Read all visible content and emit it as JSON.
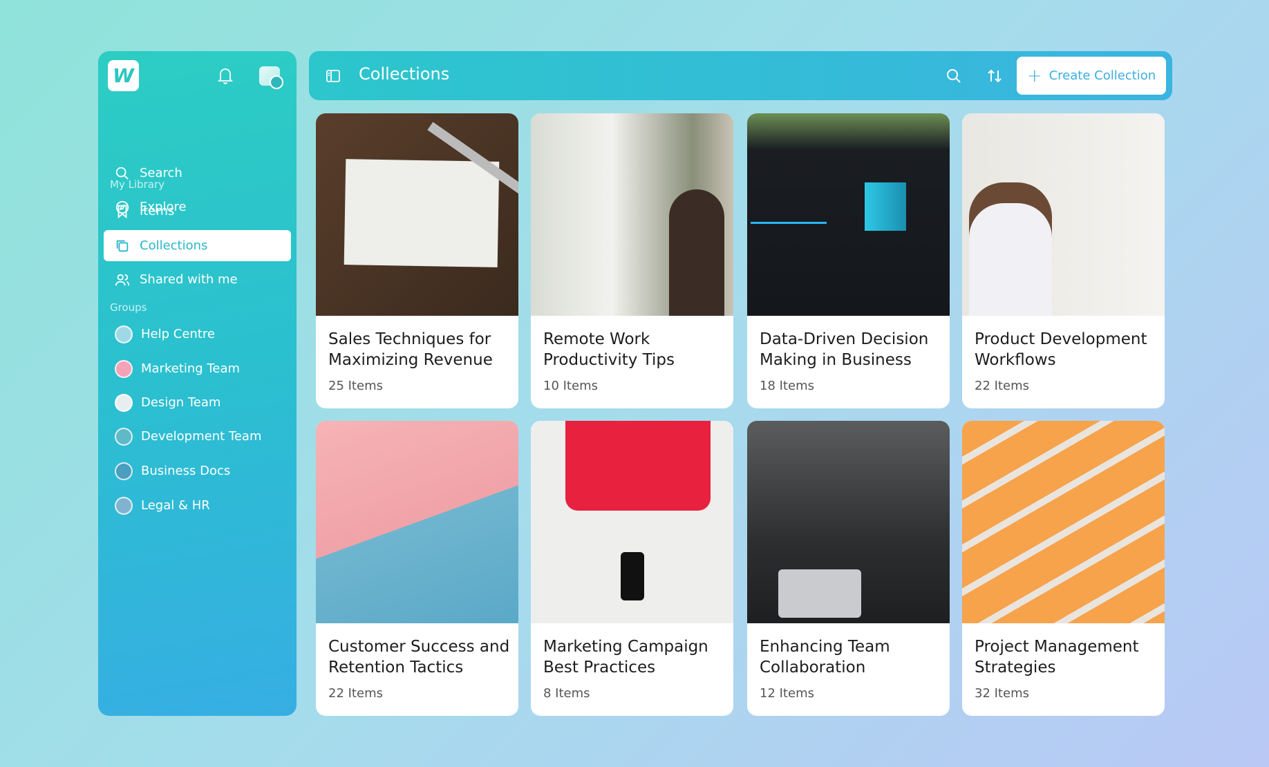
{
  "sidebar": {
    "logo": "W",
    "nav": [
      {
        "label": "Search",
        "icon": "search-icon"
      },
      {
        "label": "Explore",
        "icon": "compass-icon"
      }
    ],
    "library_heading": "My Library",
    "library": [
      {
        "label": "Items",
        "icon": "bookmark-icon"
      },
      {
        "label": "Collections",
        "icon": "collections-icon",
        "active": true
      },
      {
        "label": "Shared with me",
        "icon": "users-icon"
      }
    ],
    "groups_heading": "Groups",
    "groups": [
      {
        "label": "Help Centre",
        "color": "#9fd9e8"
      },
      {
        "label": "Marketing Team",
        "color": "#f2a3b8"
      },
      {
        "label": "Design Team",
        "color": "#e8eef0"
      },
      {
        "label": "Development Team",
        "color": "#5fb9c6"
      },
      {
        "label": "Business Docs",
        "color": "#4a9fc0"
      },
      {
        "label": "Legal & HR",
        "color": "#7fb3d0"
      }
    ]
  },
  "header": {
    "title": "Collections",
    "create_label": "Create Collection"
  },
  "collections": [
    {
      "title": "Sales Techniques for Maximizing Revenue",
      "count": "25 Items"
    },
    {
      "title": "Remote Work Productivity Tips",
      "count": "10 Items"
    },
    {
      "title": "Data-Driven Decision Making in Business",
      "count": "18 Items"
    },
    {
      "title": "Product Development Workflows",
      "count": "22 Items"
    },
    {
      "title": "Customer Success and Retention Tactics",
      "count": "22 Items"
    },
    {
      "title": "Marketing Campaign Best Practices",
      "count": "8 Items"
    },
    {
      "title": "Enhancing Team Collaboration",
      "count": "12 Items"
    },
    {
      "title": "Project Management Strategies",
      "count": "32 Items"
    }
  ]
}
